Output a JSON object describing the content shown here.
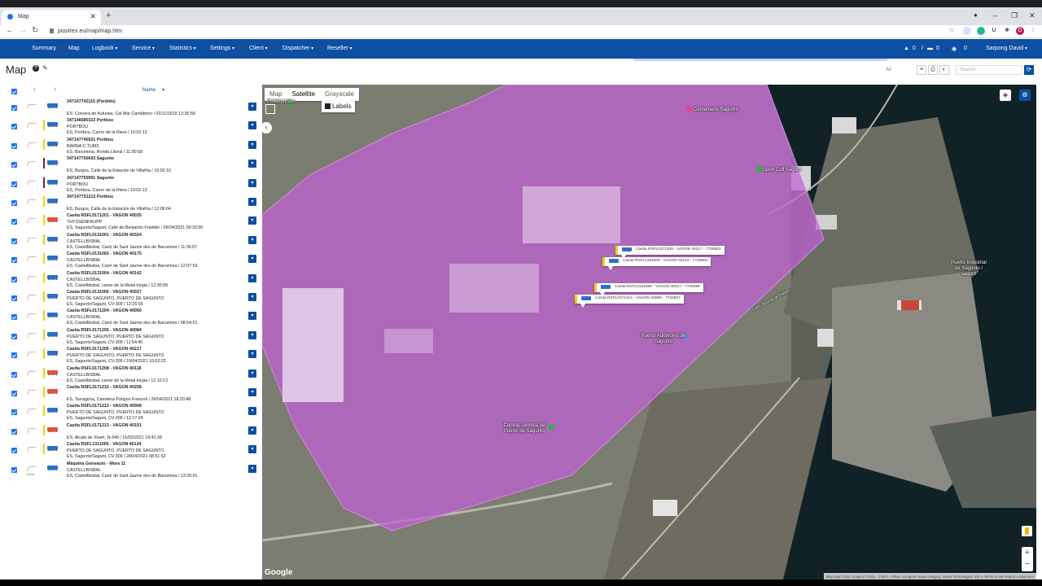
{
  "browser": {
    "tab_title": "Map",
    "url": "positrex.eu/map/map.htm",
    "profile_initial": "D"
  },
  "nav": {
    "items": [
      {
        "label": "Summary",
        "dropdown": false
      },
      {
        "label": "Map",
        "dropdown": false
      },
      {
        "label": "Logbook",
        "dropdown": true
      },
      {
        "label": "Service",
        "dropdown": true
      },
      {
        "label": "Statistics",
        "dropdown": true
      },
      {
        "label": "Settings",
        "dropdown": true
      },
      {
        "label": "Client",
        "dropdown": true
      },
      {
        "label": "Dispatcher",
        "dropdown": true
      },
      {
        "label": "Reseller",
        "dropdown": true
      }
    ],
    "alerts_count": "0",
    "trucks_count": "0",
    "viewers_count": "0",
    "user_name": "Sarpong David"
  },
  "page": {
    "title": "Map",
    "filter_label": "All",
    "search_placeholder": "Search"
  },
  "list": {
    "name_header": "Name",
    "rows": [
      {
        "line1": "347147742115 (Perdido)",
        "line2": "",
        "line3": "ES, Corvera de Asturias, Cal Mar Cantábrico / 02/11/2019 13:36:58",
        "strip": "",
        "veh": "#2a6fc9"
      },
      {
        "line1": "347146680322 Portbou",
        "line2": "PORTBOU",
        "line3": "ES, Portbou, Carrer de la Riera / 10:02:12",
        "strip": "#f2d200",
        "veh": "#2a6fc9"
      },
      {
        "line1": "347147740521 Portbou",
        "line2": "BARNA C.TUMS",
        "line3": "ES, Barcelona, Ronda Litoral / 11:00:58",
        "strip": "#f2d200",
        "veh": "#2a6fc9"
      },
      {
        "line1": "347147750603 Sagunto",
        "line2": "",
        "line3": "ES, Burgos, Calle de la Estación de Villafría / 10:02:10",
        "strip": "#8b1a1a",
        "veh": "#2a6fc9"
      },
      {
        "line1": "347147750991 Sagunto",
        "line2": "PORTBOU",
        "line3": "ES, Portbou, Carrer de la Riera / 10:02:13",
        "strip": "#8b1a1a",
        "veh": "#2a6fc9"
      },
      {
        "line1": "347147751213 Portbou",
        "line2": "",
        "line3": "ES, Burgos, Calle de la Estación de Villafría / 12:06:04",
        "strip": "#f2d200",
        "veh": "#2a6fc9"
      },
      {
        "line1": "Casita RSFL0171201 - VAGON 40035",
        "line2": "THYSSENKRUPP",
        "line3": "ES, Sagunto/Sagunt, Calle de Benjamin Franklin / 06/04/2021 09:33:00",
        "strip": "#f2d200",
        "veh": "#e0533a"
      },
      {
        "line1": "Casita RSFL0131001 - VAGON 40324",
        "line2": "CASTELLBISBAL",
        "line3": "ES, Castellbisbal, Camí de Sant Jaume des de Barcelona / 11:36:07",
        "strip": "#f2d200",
        "veh": "#2a6fc9"
      },
      {
        "line1": "Casita RSFL0131002 - VAGON 40175",
        "line2": "CASTELLBISBAL",
        "line3": "ES, Castellbisbal, Camí de Sant Jaume des de Barcelona / 12:07:53",
        "strip": "#f2d200",
        "veh": "#2a6fc9"
      },
      {
        "line1": "Casita RSFL0131004 - VAGON 40142",
        "line2": "CASTELLBISBAL",
        "line3": "ES, Castellbisbal, carrer de la Metal·lúrgia / 12:30:58",
        "strip": "#f2d200",
        "veh": "#2a6fc9"
      },
      {
        "line1": "Casita RSFL0131006 - VAGON 40027",
        "line2": "PUERTO DE SAGUNTO, PUERTO DE SAGUNTO",
        "line3": "ES, Sagunto/Sagunt, CV-309 / 12:26:55",
        "strip": "#f2d200",
        "veh": "#2a6fc9"
      },
      {
        "line1": "Casita RSFL0171204 - VAGON 40050",
        "line2": "CASTELLBISBAL",
        "line3": "ES, Castellbisbal, Camí de Sant Jaume des de Barcelona / 08:54:51",
        "strip": "#f2d200",
        "veh": "#2a6fc9"
      },
      {
        "line1": "Casita RSFL0171205 - VAGON 40084",
        "line2": "PUERTO DE SAGUNTO, PUERTO DE SAGUNTO",
        "line3": "ES, Sagunto/Sagunt, CV-309 / 11:54:40",
        "strip": "#f2d200",
        "veh": "#2a6fc9"
      },
      {
        "line1": "Casita RSFL0171206 - VAGON 40217",
        "line2": "PUERTO DE SAGUNTO, PUERTO DE SAGUNTO",
        "line3": "ES, Sagunto/Sagunt, CV-309 / 10/04/2021 10:02:23",
        "strip": "#f2d200",
        "veh": "#2a6fc9"
      },
      {
        "line1": "Casita RSFL0171208 - VAGON 40118",
        "line2": "CASTELLBISBAL",
        "line3": "ES, Castellbisbal, carrer de la Metal·lúrgia / 12:10:13",
        "strip": "#f2d200",
        "veh": "#e0533a"
      },
      {
        "line1": "Casita RSFL0171210 - VAGON 40258",
        "line2": "",
        "line3": "ES, Tarragona, Carretera Polígon Francolí / 26/04/2021 18:20:48",
        "strip": "#f2d200",
        "veh": "#e0533a"
      },
      {
        "line1": "Casita RSFL0171212 - VAGON 40068",
        "line2": "PUERTO DE SAGUNTO, PUERTO DE SAGUNTO",
        "line3": "ES, Sagunto/Sagunt, CV-309 / 12:17:24",
        "strip": "#f2d200",
        "veh": "#2a6fc9"
      },
      {
        "line1": "Casita RSFL0171213 - VAGON 40191",
        "line2": "",
        "line3": "ES, Alcalà de Xivert, N-340 / 15/02/2021 19:41:28",
        "strip": "#f2d200",
        "veh": "#e0533a"
      },
      {
        "line1": "Casita RSFL1311005 - VAGON 40134",
        "line2": "PUERTO DE SAGUNTO, PUERTO DE SAGUNTO",
        "line3": "ES, Sagunto/Sagunt, CV-309 / 28/04/2021 08:51:52",
        "strip": "#f2d200",
        "veh": "#2a6fc9"
      },
      {
        "line1": "Máquina Gonvauto - Mora 11",
        "line2": "CASTELLBISBAL",
        "line3": "ES, Castellbisbal, Camí de Sant Jaume des de Barcelona / 13:39:01",
        "strip": "",
        "veh": "#2a6fc9",
        "signal_label": "Sleep"
      }
    ]
  },
  "map": {
    "types": [
      "Map",
      "Satellite",
      "Grayscale"
    ],
    "selected_type": "Satellite",
    "labels_toggle": "Labels",
    "vehicle_labels": [
      "Casita RSFL0171206 - VAGON 40217 - 7726602",
      "Casita RSFL1311005 - VAGON 40134 - 7726604",
      "Casita RSFL0131006 - VAGON 40027 - 7726599",
      "Casita RSFL0171212 - VAGON 40068 - 7726607"
    ],
    "places": [
      {
        "name": "Polideportivo",
        "color": "#2bb24c"
      },
      {
        "name": "Cementerio Sagunto",
        "color": "#e8457c"
      },
      {
        "name": "Sport Coll Sagunt",
        "color": "#2bb24c"
      },
      {
        "name": "Puerto Industrial de Sagunto / sagunt",
        "color": ""
      },
      {
        "name": "Puerto Autónomo de Sagunto",
        "color": "#5b8def"
      },
      {
        "name": "Central Térmica de Puerto de Sagunto",
        "color": "#2bb24c"
      },
      {
        "name": "Cam. Acceso al Puerto",
        "color": ""
      }
    ],
    "attribution": "Map data ©2021 Imagery ©2021 , CNES / Airbus, European Space Imaging, Maxar Technologies   100 m   Terms of Use   Report a map error",
    "brand": "Google",
    "geofence_color": "#c15fd6"
  }
}
